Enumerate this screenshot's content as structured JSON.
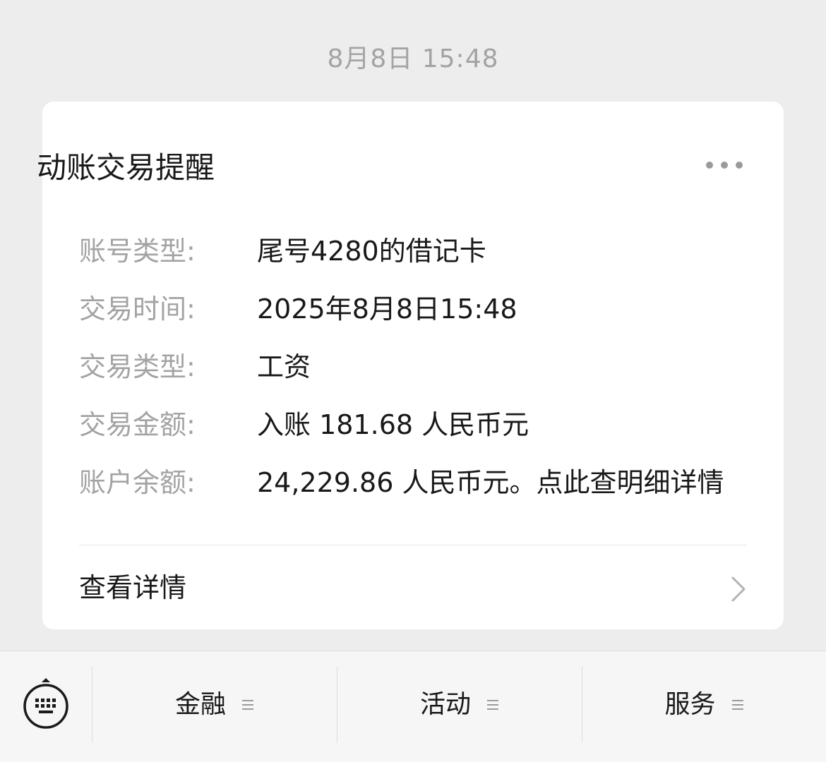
{
  "chat": {
    "timestamp": "8月8日 15:48"
  },
  "card": {
    "title": "动账交易提醒",
    "more_icon": "more-dots-icon",
    "rows": [
      {
        "label": "账号类型:",
        "value": "尾号4280的借记卡"
      },
      {
        "label": "交易时间:",
        "value": "2025年8月8日15:48"
      },
      {
        "label": "交易类型:",
        "value": "工资"
      },
      {
        "label": "交易金额:",
        "value": "入账 181.68 人民币元"
      },
      {
        "label": "账户余额:",
        "value": "24,229.86 人民币元。点此查明细详情"
      }
    ],
    "detail_link": "查看详情",
    "detail_icon": "chevron-right-icon"
  },
  "bottom_menu": {
    "keyboard_icon": "keyboard-icon",
    "items": [
      {
        "label": "金融",
        "icon": "submenu-lines-icon"
      },
      {
        "label": "活动",
        "icon": "submenu-lines-icon"
      },
      {
        "label": "服务",
        "icon": "submenu-lines-icon"
      }
    ]
  },
  "colors": {
    "background": "#ededed",
    "card": "#ffffff",
    "label_gray": "#a3a3a3",
    "text_dark": "#191919"
  }
}
